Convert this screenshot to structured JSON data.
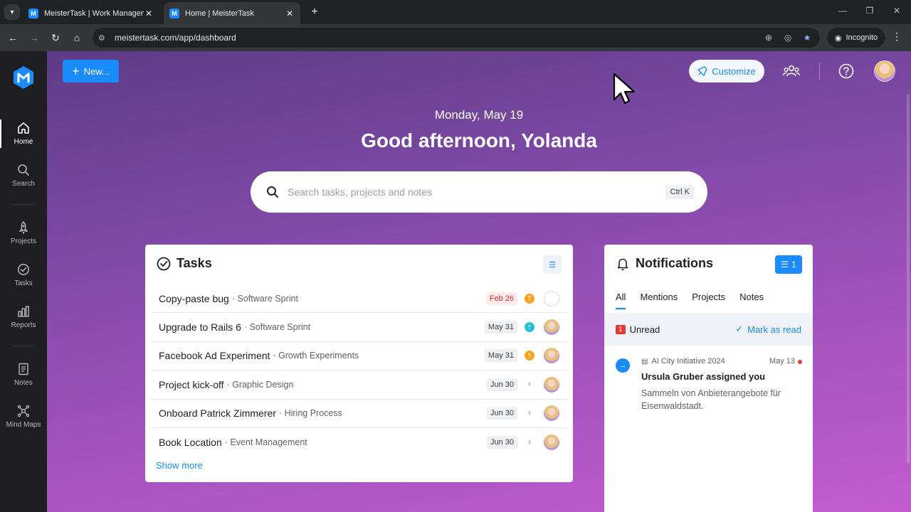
{
  "browser": {
    "tabs": [
      {
        "title": "MeisterTask | Work Management",
        "favicon": "M"
      },
      {
        "title": "Home | MeisterTask",
        "favicon": "M"
      }
    ],
    "url": "meistertask.com/app/dashboard",
    "incognito_label": "Incognito"
  },
  "sidebar": {
    "items": [
      {
        "label": "Home",
        "icon": "home-icon"
      },
      {
        "label": "Search",
        "icon": "search-icon"
      },
      {
        "label": "Projects",
        "icon": "rocket-icon"
      },
      {
        "label": "Tasks",
        "icon": "check-circle-icon"
      },
      {
        "label": "Reports",
        "icon": "bar-chart-icon"
      },
      {
        "label": "Notes",
        "icon": "note-icon"
      },
      {
        "label": "Mind Maps",
        "icon": "mindmap-icon"
      }
    ]
  },
  "header": {
    "new_label": "New...",
    "customize_label": "Customize"
  },
  "hero": {
    "date": "Monday, May 19",
    "greeting": "Good afternoon, Yolanda"
  },
  "search": {
    "placeholder": "Search tasks, projects and notes",
    "shortcut": "Ctrl K"
  },
  "tasks": {
    "title": "Tasks",
    "rows": [
      {
        "name": "Copy-paste bug",
        "project": "Software Sprint",
        "due": "Feb 26"
      },
      {
        "name": "Upgrade to Rails 6",
        "project": "Software Sprint",
        "due": "May 31"
      },
      {
        "name": "Facebook Ad Experiment",
        "project": "Growth Experiments",
        "due": "May 31"
      },
      {
        "name": "Project kick-off",
        "project": "Graphic Design",
        "due": "Jun 30"
      },
      {
        "name": "Onboard Patrick Zimmerer",
        "project": "Hiring Process",
        "due": "Jun 30"
      },
      {
        "name": "Book Location",
        "project": "Event Management",
        "due": "Jun 30"
      }
    ],
    "show_more": "Show more"
  },
  "notifications": {
    "title": "Notifications",
    "filter_count": "1",
    "tabs": [
      "All",
      "Mentions",
      "Projects",
      "Notes"
    ],
    "unread_count": "1",
    "unread_label": "Unread",
    "mark_read": "Mark as read",
    "item": {
      "project": "AI City Initiative 2024",
      "date": "May 13",
      "title": "Ursula Gruber assigned you",
      "body": "Sammeln von Anbieterangebote für Eisenwaldstadt."
    }
  },
  "colors": {
    "accent": "#1a8cff",
    "overdue": "#d93025",
    "status_orange": "#f5a623",
    "status_teal": "#29c0d6"
  }
}
